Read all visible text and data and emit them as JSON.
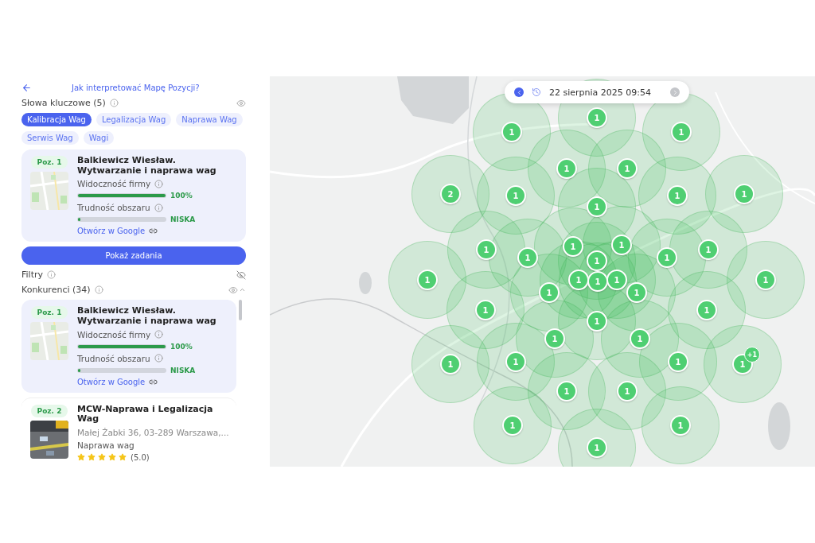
{
  "header": {
    "help_link": "Jak interpretować Mapę Pozycji?"
  },
  "keywords": {
    "title": "Słowa kluczowe (5)",
    "visible": true,
    "items": [
      {
        "label": "Kalibracja Wag",
        "selected": true
      },
      {
        "label": "Legalizacja Wag",
        "selected": false
      },
      {
        "label": "Naprawa Wag",
        "selected": false
      },
      {
        "label": "Serwis Wag",
        "selected": false
      },
      {
        "label": "Wagi",
        "selected": false
      }
    ]
  },
  "business_card": {
    "position": "Poz. 1",
    "name": "Balkiewicz Wiesław. Wytwarzanie i naprawa wag",
    "visibility_label": "Widoczność firmy",
    "visibility": {
      "level": 1,
      "reading": "100%"
    },
    "difficulty_label": "Trudność obszaru",
    "difficulty": {
      "level": 0.03,
      "reading": "NISKA"
    },
    "link": "Otwórz w Google"
  },
  "tasks_button": "Pokaż zadania",
  "filters": {
    "title": "Filtry",
    "visible": false
  },
  "competitors": {
    "title": "Konkurenci (34)",
    "visible": true,
    "items": [
      {
        "kind": "metrics",
        "highlighted": true,
        "position": "Poz. 1",
        "name": "Balkiewicz Wiesław. Wytwarzanie i naprawa wag",
        "visibility_label": "Widoczność firmy",
        "visibility": {
          "level": 1,
          "reading": "100%"
        },
        "difficulty_label": "Trudność obszaru",
        "difficulty": {
          "level": 0.03,
          "reading": "NISKA"
        },
        "link": "Otwórz w Google"
      },
      {
        "kind": "listing",
        "highlighted": false,
        "position": "Poz. 2",
        "name": "MCW-Naprawa i Legalizacja Wag",
        "address": "Małej Żabki 36, 03-289 Warszawa,...",
        "category": "Naprawa wag",
        "stars": 5,
        "rating": "(5.0)"
      }
    ]
  },
  "map": {
    "date": "22 sierpnia 2025 09:54",
    "markers": [
      {
        "label": "1"
      },
      {
        "label": "1"
      },
      {
        "label": "1"
      },
      {
        "label": "1"
      },
      {
        "label": "1"
      },
      {
        "label": "2"
      },
      {
        "label": "1"
      },
      {
        "label": "1"
      },
      {
        "label": "1"
      },
      {
        "label": "1"
      },
      {
        "label": "1"
      },
      {
        "label": "1"
      },
      {
        "label": "1"
      },
      {
        "label": "1"
      },
      {
        "label": "1"
      },
      {
        "label": "1"
      },
      {
        "label": "1"
      },
      {
        "label": "1"
      },
      {
        "label": "1"
      },
      {
        "label": "1"
      },
      {
        "label": "1"
      },
      {
        "label": "1"
      },
      {
        "label": "1"
      },
      {
        "label": "1"
      },
      {
        "label": "1"
      },
      {
        "label": "1"
      },
      {
        "label": "1"
      },
      {
        "label": "1"
      },
      {
        "label": "1"
      },
      {
        "label": "1"
      },
      {
        "label": "1"
      },
      {
        "label": "1"
      },
      {
        "label": "1",
        "extra": "+1"
      },
      {
        "label": "1"
      },
      {
        "label": "1"
      },
      {
        "label": "1"
      },
      {
        "label": "1"
      },
      {
        "label": "1"
      }
    ]
  }
}
